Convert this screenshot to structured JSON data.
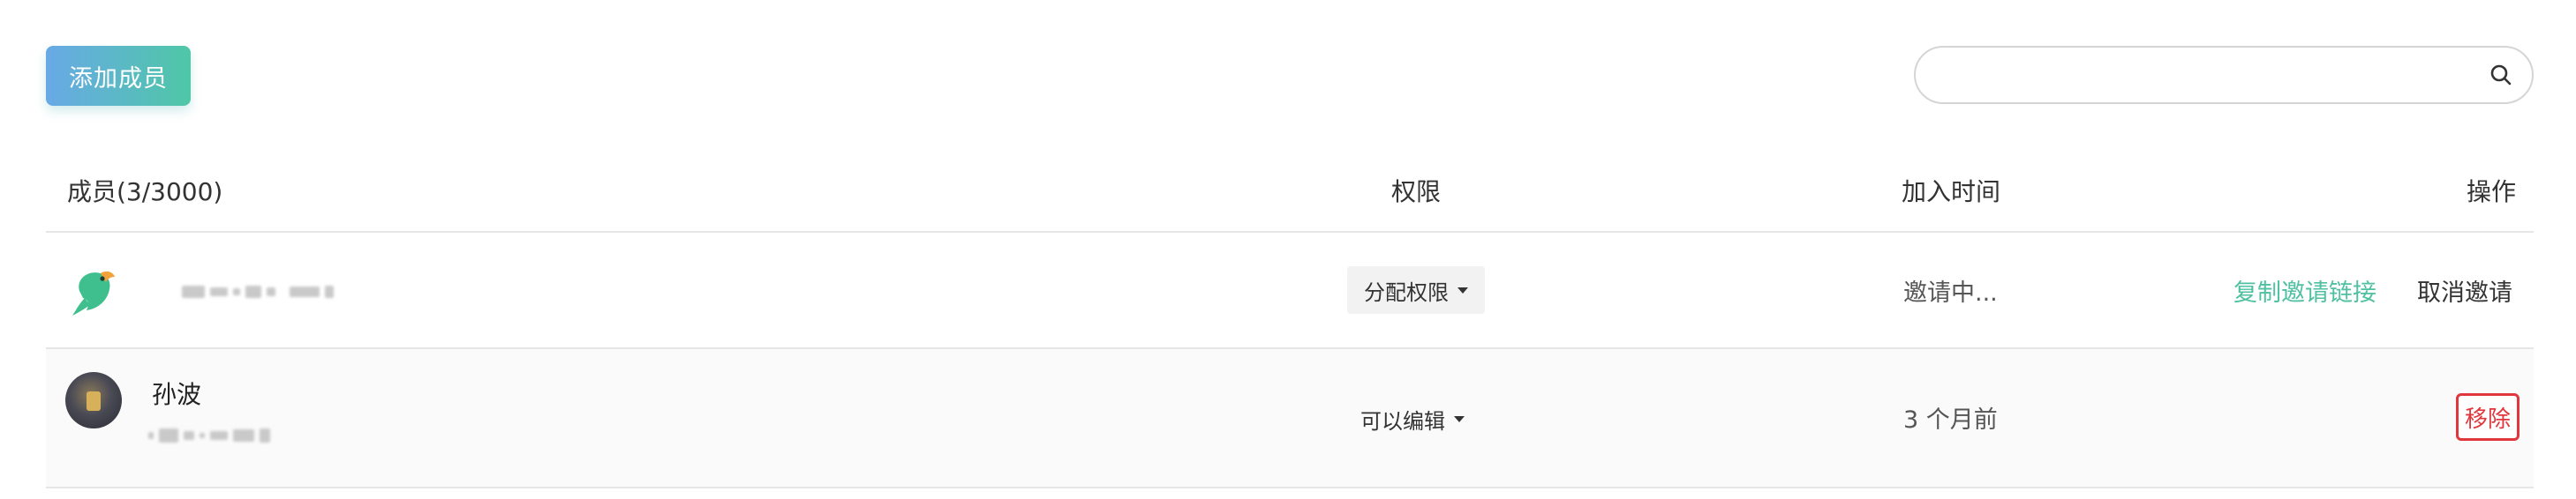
{
  "toolbar": {
    "add_member_label": "添加成员",
    "search_placeholder": ""
  },
  "table": {
    "header": {
      "member": "成员(3/3000)",
      "permission": "权限",
      "joined": "加入时间",
      "actions": "操作"
    },
    "rows": [
      {
        "avatar_icon": "parrot-icon",
        "name": "",
        "permission": "分配权限",
        "joined": "邀请中...",
        "actions": [
          "复制邀请链接",
          "取消邀请"
        ]
      },
      {
        "avatar_icon": "user-avatar",
        "name": "孙波",
        "permission": "可以编辑",
        "joined": "3 个月前",
        "actions": [
          "移除"
        ]
      }
    ]
  },
  "colors": {
    "accent_green": "#4fc0a0",
    "danger": "#e0363c",
    "button_gradient_start": "#68a9e6",
    "button_gradient_end": "#4fc7a7"
  }
}
